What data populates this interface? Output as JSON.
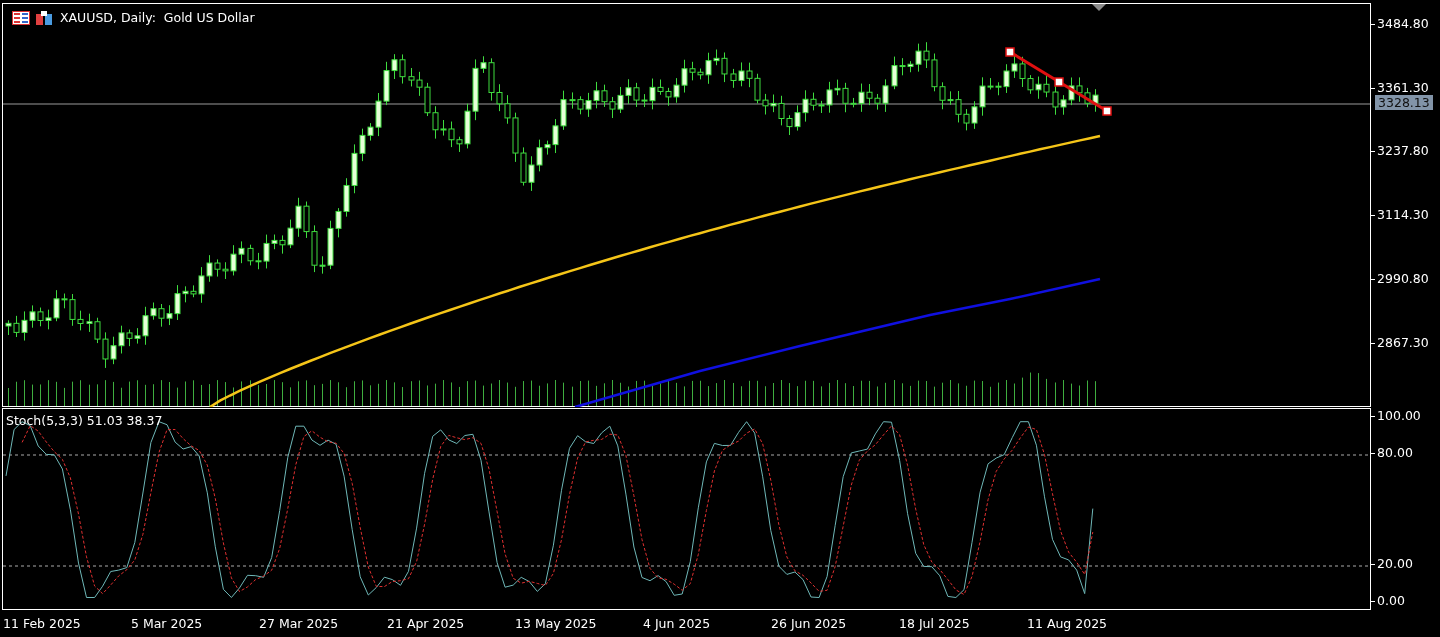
{
  "chart_title": "XAUUSD, Daily:  Gold US Dollar",
  "price_axis": {
    "ticks": [
      "3484.80",
      "3361.30",
      "3237.80",
      "3114.30",
      "2990.80",
      "2867.30"
    ],
    "current_price": "3328.13"
  },
  "indicator": {
    "label": "Stoch(5,3,3) 51.03 38.37",
    "ticks": [
      "100.00",
      "80.00",
      "20.00",
      "0.00"
    ]
  },
  "date_axis": [
    "11 Feb 2025",
    "5 Mar 2025",
    "27 Mar 2025",
    "21 Apr 2025",
    "13 May 2025",
    "4 Jun 2025",
    "26 Jun 2025",
    "18 Jul 2025",
    "11 Aug 2025"
  ]
}
